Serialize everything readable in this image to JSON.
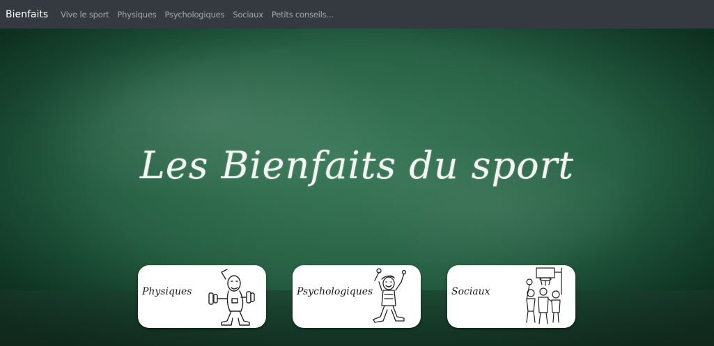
{
  "navbar": {
    "brand": "Bienfaits",
    "links": [
      "Vive le sport",
      "Physiques",
      "Psychologiques",
      "Sociaux",
      "Petits conseils..."
    ]
  },
  "hero": {
    "title": "Les Bienfaits du sport"
  },
  "cards": [
    {
      "label": "Physiques",
      "icon": "weightlifter-drawing-icon"
    },
    {
      "label": "Psychologiques",
      "icon": "happy-person-drawing-icon"
    },
    {
      "label": "Sociaux",
      "icon": "basketball-group-drawing-icon"
    }
  ],
  "colors": {
    "navbar_bg": "#343a40",
    "chalkboard_green": "#2a6447",
    "card_bg": "#ffffff"
  }
}
